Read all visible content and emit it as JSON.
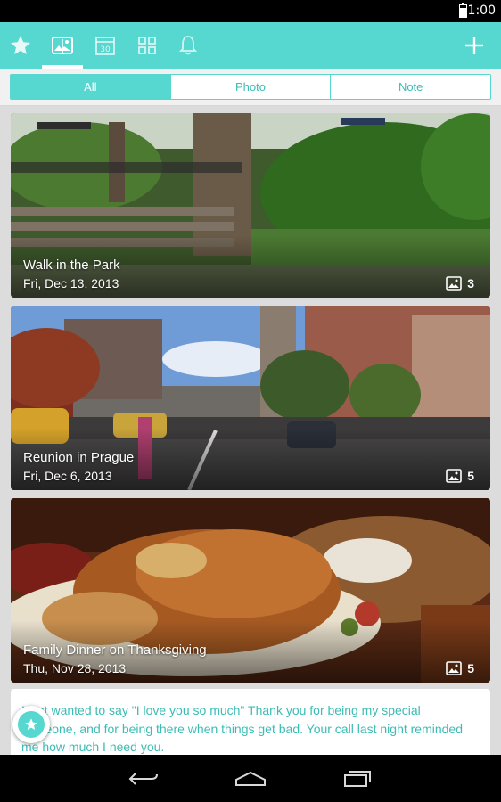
{
  "status_bar": {
    "time": "1:00"
  },
  "action_bar": {
    "icons": [
      "star-icon",
      "album-icon",
      "calendar-icon",
      "grid-icon",
      "bell-icon",
      "add-icon"
    ],
    "calendar_day": "30",
    "active_tab": "album-icon"
  },
  "filter_tabs": [
    {
      "label": "All",
      "selected": true
    },
    {
      "label": "Photo",
      "selected": false
    },
    {
      "label": "Note",
      "selected": false
    }
  ],
  "entries": [
    {
      "title": "Walk in the Park",
      "date": "Fri, Dec 13, 2013",
      "photo_count": "3"
    },
    {
      "title": "Reunion in Prague",
      "date": "Fri, Dec 6, 2013",
      "photo_count": "5"
    },
    {
      "title": "Family Dinner on Thanksgiving",
      "date": "Thu, Nov 28, 2013",
      "photo_count": "5"
    }
  ],
  "note": {
    "text": "I just wanted to say \"I love you so much\" Thank you for being my special someone, and for being there when things get bad. Your call last night reminded me how much I need you."
  },
  "colors": {
    "accent": "#56d7cf",
    "accent_text": "#3cbcb4",
    "background": "#dcdcdc"
  }
}
